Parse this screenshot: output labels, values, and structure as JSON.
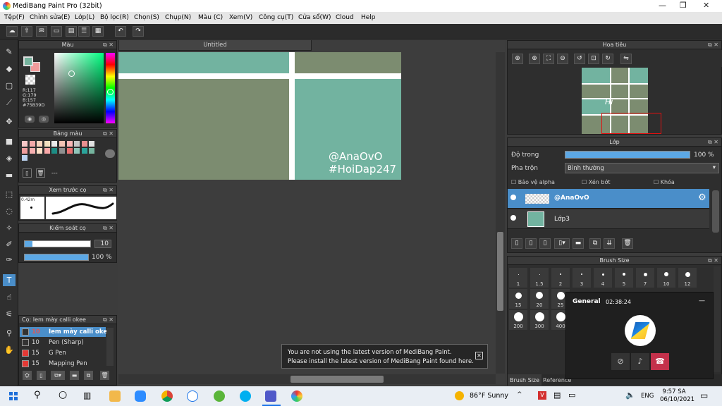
{
  "window": {
    "title": "MediBang Paint Pro (32bit)",
    "minimize": "—",
    "restore": "❐",
    "close": "✕"
  },
  "menu": [
    "Tệp(F)",
    "Chỉnh sửa(E)",
    "Lớp(L)",
    "Bộ lọc(R)",
    "Chọn(S)",
    "Chụp(N)",
    "Màu (C)",
    "Xem(V)",
    "Công cụ(T)",
    "Cửa sổ(W)",
    "Cloud",
    "Help"
  ],
  "color_panel": {
    "title": "Màu",
    "r": "R:117",
    "g": "G:179",
    "b": "B:157",
    "hex": "#75B39D",
    "fg": "#75b39d",
    "bg": "#f29b9b"
  },
  "palette_panel": {
    "title": "Bảng màu",
    "more": "---",
    "colors": [
      "#f5c6c6",
      "#f3a9a9",
      "#f7d3bd",
      "#f1e0c0",
      "#e9e9e9",
      "#f2c4b5",
      "#f8b6b6",
      "#c6c6c6",
      "#e98f8f",
      "#e1e1e1",
      "#ee9c9c",
      "#f6b0b0",
      "#fde0c6",
      "#f8a8a8",
      "#1d8c84",
      "#8f8f8f",
      "#e87070",
      "#8fc4b9",
      "#2aa39a",
      "#75b39d",
      "#bcd3f0"
    ]
  },
  "brush_preview": {
    "title": "Xem trước cọ",
    "size": "0.42m"
  },
  "brush_control": {
    "title": "Kiểm soát cọ",
    "size_value": "10",
    "opacity_value": "100 %",
    "size_fraction": 0.12,
    "opacity_fraction": 1.0
  },
  "brush_list": {
    "title": "Cọ: Iem mày calli okee",
    "items": [
      {
        "size": "10",
        "name": "Iem mày calli okee",
        "color": "#333333",
        "selected": true
      },
      {
        "size": "10",
        "name": "Pen (Sharp)",
        "color": "#333333",
        "selected": false
      },
      {
        "size": "15",
        "name": "G Pen",
        "color": "#e53935",
        "selected": false
      },
      {
        "size": "15",
        "name": "Mapping Pen",
        "color": "#e53935",
        "selected": false
      }
    ]
  },
  "document": {
    "tab": "Untitled",
    "watermark1": "@AnaOvO",
    "watermark2": "#HoiDap247"
  },
  "navigator": {
    "title": "Hoa tiêu",
    "thumb_text": "Hi"
  },
  "layer_panel": {
    "title": "Lớp",
    "opacity_label": "Độ trong",
    "opacity_value": "100 %",
    "opacity_fraction": 1.0,
    "blend_label": "Pha trộn",
    "blend_value": "Bình thường",
    "protect_alpha": "Bảo vệ alpha",
    "clip": "Xén bớt",
    "lock": "Khóa",
    "layers": [
      {
        "name": "@AnaOvO",
        "selected": true
      },
      {
        "name": "Lớp3",
        "selected": false
      }
    ]
  },
  "brush_size": {
    "title": "Brush Size",
    "sizes": [
      "1",
      "1.5",
      "2",
      "3",
      "4",
      "5",
      "7",
      "10",
      "12",
      "15",
      "20",
      "25",
      "200",
      "300",
      "400"
    ],
    "tab1": "Brush Size",
    "tab2": "Reference"
  },
  "call": {
    "title": "General",
    "time": "02:38:24",
    "minimize": "—"
  },
  "notice": {
    "line1": "You are not using the latest version of MediBang Paint.",
    "line2": "Please install the latest version of MediBang Paint found here.",
    "close": "✕"
  },
  "taskbar": {
    "weather": "86°F  Sunny",
    "lang": "ENG",
    "time": "9:57 SA",
    "date": "06/10/2021"
  }
}
